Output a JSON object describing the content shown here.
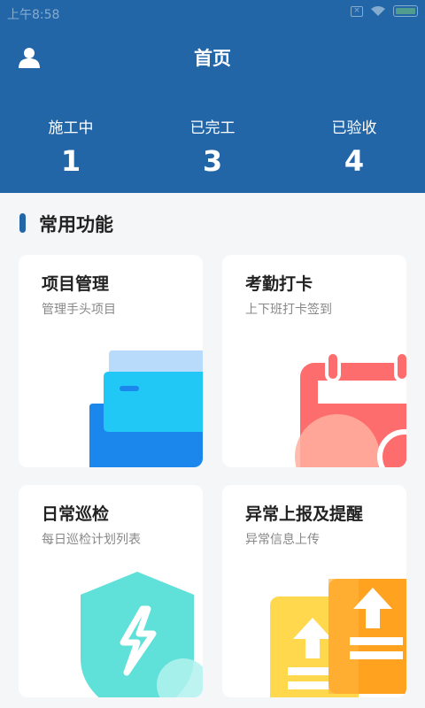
{
  "status_bar": {
    "time": "上午8:58"
  },
  "header": {
    "title": "首页"
  },
  "stats": [
    {
      "label": "施工中",
      "value": "1"
    },
    {
      "label": "已完工",
      "value": "3"
    },
    {
      "label": "已验收",
      "value": "4"
    }
  ],
  "section": {
    "title": "常用功能"
  },
  "cards": [
    {
      "title": "项目管理",
      "subtitle": "管理手头项目",
      "icon": "folder-icon"
    },
    {
      "title": "考勤打卡",
      "subtitle": "上下班打卡签到",
      "icon": "calendar-icon"
    },
    {
      "title": "日常巡检",
      "subtitle": "每日巡检计划列表",
      "icon": "shield-icon"
    },
    {
      "title": "异常上报及提醒",
      "subtitle": "异常信息上传",
      "icon": "upload-document-icon"
    }
  ],
  "colors": {
    "primary": "#2266a8",
    "background": "#f5f6f8"
  }
}
